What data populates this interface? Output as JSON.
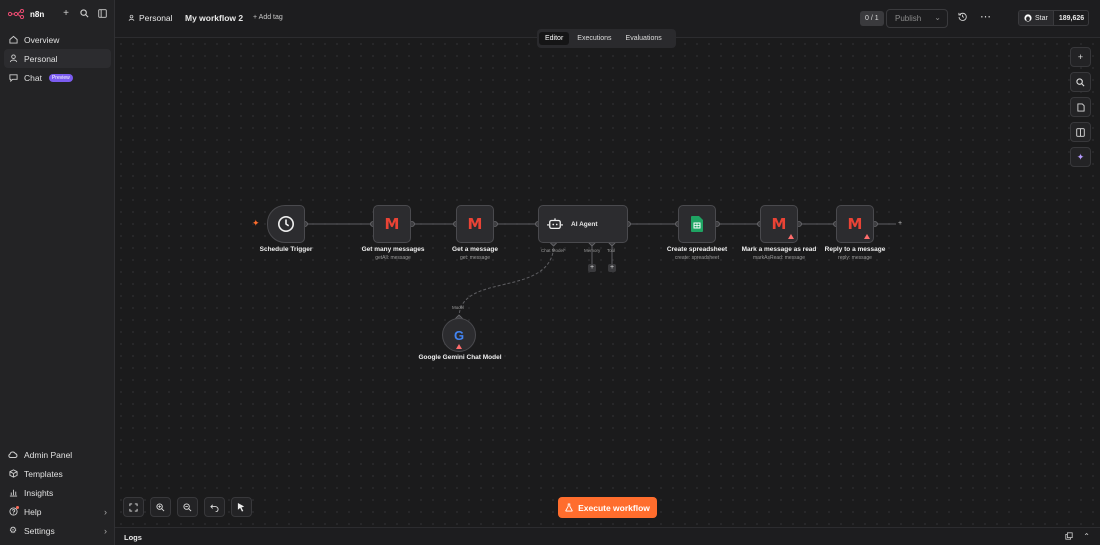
{
  "brand": {
    "name": "n8n"
  },
  "sidebar": {
    "top_items": [
      {
        "label": "Overview",
        "icon": "home-icon"
      },
      {
        "label": "Personal",
        "icon": "user-icon"
      },
      {
        "label": "Chat",
        "icon": "chat-icon",
        "badge": "Preview"
      }
    ],
    "bottom_items": [
      {
        "label": "Admin Panel",
        "icon": "cloud-icon"
      },
      {
        "label": "Templates",
        "icon": "box-icon"
      },
      {
        "label": "Insights",
        "icon": "chart-icon"
      },
      {
        "label": "Help",
        "icon": "help-icon"
      },
      {
        "label": "Settings",
        "icon": "gear-icon"
      }
    ]
  },
  "header": {
    "project": "Personal",
    "workflow_name": "My workflow 2",
    "add_tag": "+ Add tag",
    "version_count": "0 / 1",
    "publish_label": "Publish",
    "github_star": "Star",
    "github_count": "189,626"
  },
  "tabs": [
    "Editor",
    "Executions",
    "Evaluations"
  ],
  "nodes": {
    "schedule": {
      "label": "Schedule Trigger"
    },
    "get_many": {
      "label": "Get many messages",
      "sub": "getAll: message"
    },
    "get_one": {
      "label": "Get a message",
      "sub": "get: message"
    },
    "agent": {
      "label": "AI Agent",
      "ports": [
        "Chat Model*",
        "Memory",
        "Tool"
      ]
    },
    "sheet": {
      "label": "Create spreadsheet",
      "sub": "create: spreadsheet"
    },
    "mark_read": {
      "label": "Mark a message as read",
      "sub": "markAsRead: message"
    },
    "reply": {
      "label": "Reply to a message",
      "sub": "reply: message"
    },
    "gemini": {
      "label": "Google Gemini Chat Model",
      "port": "Model"
    }
  },
  "execute_button": "Execute workflow",
  "logs_label": "Logs",
  "colors": {
    "accent": "#ff6d2d",
    "preview_badge": "#7b5cf0",
    "warning": "#ff6d6d",
    "sheets_green": "#1fa463"
  }
}
